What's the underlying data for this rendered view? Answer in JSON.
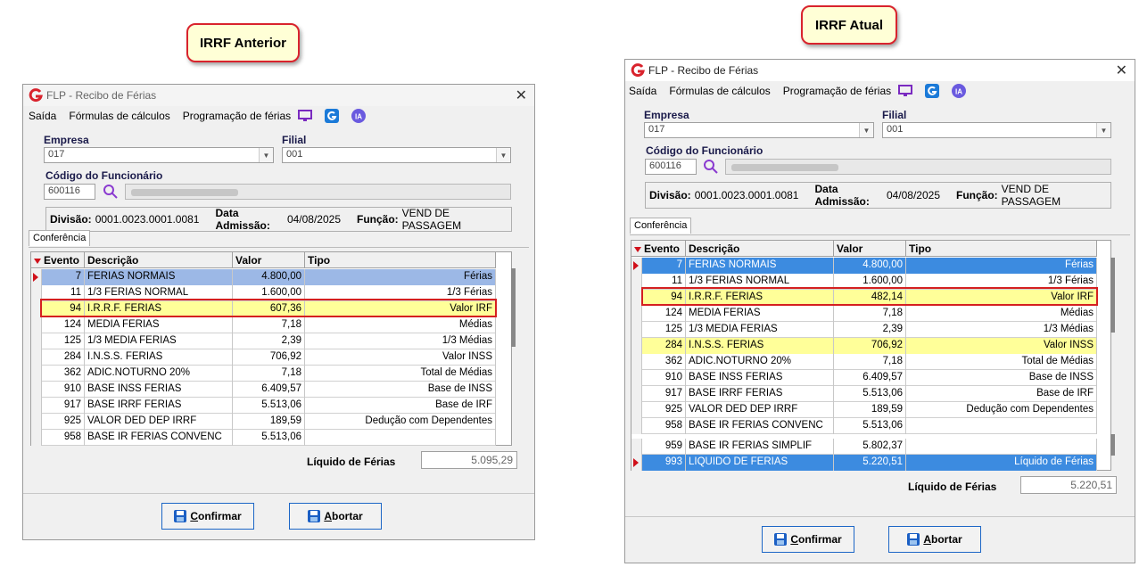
{
  "callouts": {
    "left": "IRRF Anterior",
    "right": "IRRF Atual"
  },
  "window": {
    "title": "FLP - Recibo de Férias",
    "close_glyph": "✕",
    "menu": {
      "exit": "Saída",
      "formulas": "Fórmulas de cálculos",
      "programacao": "Programação de férias"
    },
    "icons": [
      "monitor-icon",
      "g-logo-icon",
      "ia-icon"
    ],
    "ia_label": "IA",
    "labels": {
      "empresa": "Empresa",
      "filial": "Filial",
      "codigo": "Código do Funcionário"
    },
    "empresa_value": "017",
    "filial_value": "001",
    "codigo_value": "600116",
    "info": {
      "divisao_label": "Divisão:",
      "divisao_value": "0001.0023.0001.0081",
      "admissao_label": "Data Admissão:",
      "admissao_value": "04/08/2025",
      "funcao_label": "Função:",
      "funcao_value": "VEND DE PASSAGEM"
    },
    "tab": "Conferência",
    "columns": [
      "Evento",
      "Descrição",
      "Valor",
      "Tipo"
    ],
    "liquido_label": "Líquido de Férias",
    "buttons": {
      "confirm": "Confirmar",
      "abort": "Abortar"
    }
  },
  "left": {
    "rows": [
      {
        "evento": "7",
        "descricao": "FERIAS NORMAIS",
        "valor": "4.800,00",
        "tipo": "Férias"
      },
      {
        "evento": "11",
        "descricao": "1/3 FERIAS NORMAL",
        "valor": "1.600,00",
        "tipo": "1/3 Férias"
      },
      {
        "evento": "94",
        "descricao": "I.R.R.F. FERIAS",
        "valor": "607,36",
        "tipo": "Valor IRF"
      },
      {
        "evento": "124",
        "descricao": "MEDIA FERIAS",
        "valor": "7,18",
        "tipo": "Médias"
      },
      {
        "evento": "125",
        "descricao": "1/3 MEDIA FERIAS",
        "valor": "2,39",
        "tipo": "1/3 Médias"
      },
      {
        "evento": "284",
        "descricao": "I.N.S.S. FERIAS",
        "valor": "706,92",
        "tipo": "Valor INSS"
      },
      {
        "evento": "362",
        "descricao": "ADIC.NOTURNO 20%",
        "valor": "7,18",
        "tipo": "Total de Médias"
      },
      {
        "evento": "910",
        "descricao": "BASE INSS FERIAS",
        "valor": "6.409,57",
        "tipo": "Base de INSS"
      },
      {
        "evento": "917",
        "descricao": "BASE IRRF FERIAS",
        "valor": "5.513,06",
        "tipo": "Base de IRF"
      },
      {
        "evento": "925",
        "descricao": "VALOR DED DEP IRRF",
        "valor": "189,59",
        "tipo": "Dedução com Dependentes"
      },
      {
        "evento": "958",
        "descricao": "BASE IR FERIAS CONVENC",
        "valor": "5.513,06",
        "tipo": ""
      }
    ],
    "liquido_value": "5.095,29"
  },
  "right": {
    "rows": [
      {
        "evento": "7",
        "descricao": "FERIAS NORMAIS",
        "valor": "4.800,00",
        "tipo": "Férias"
      },
      {
        "evento": "11",
        "descricao": "1/3 FERIAS NORMAL",
        "valor": "1.600,00",
        "tipo": "1/3 Férias"
      },
      {
        "evento": "94",
        "descricao": "I.R.R.F. FERIAS",
        "valor": "482,14",
        "tipo": "Valor IRF"
      },
      {
        "evento": "124",
        "descricao": "MEDIA FERIAS",
        "valor": "7,18",
        "tipo": "Médias"
      },
      {
        "evento": "125",
        "descricao": "1/3 MEDIA FERIAS",
        "valor": "2,39",
        "tipo": "1/3 Médias"
      },
      {
        "evento": "284",
        "descricao": "I.N.S.S. FERIAS",
        "valor": "706,92",
        "tipo": "Valor INSS"
      },
      {
        "evento": "362",
        "descricao": "ADIC.NOTURNO 20%",
        "valor": "7,18",
        "tipo": "Total de Médias"
      },
      {
        "evento": "910",
        "descricao": "BASE INSS FERIAS",
        "valor": "6.409,57",
        "tipo": "Base de INSS"
      },
      {
        "evento": "917",
        "descricao": "BASE IRRF FERIAS",
        "valor": "5.513,06",
        "tipo": "Base de IRF"
      },
      {
        "evento": "925",
        "descricao": "VALOR DED DEP IRRF",
        "valor": "189,59",
        "tipo": "Dedução com Dependentes"
      },
      {
        "evento": "958",
        "descricao": "BASE IR FERIAS CONVENC",
        "valor": "5.513,06",
        "tipo": ""
      },
      {
        "evento": "959",
        "descricao": "BASE IR FERIAS SIMPLIF",
        "valor": "5.802,37",
        "tipo": ""
      },
      {
        "evento": "993",
        "descricao": "LIQUIDO DE FERIAS",
        "valor": "5.220,51",
        "tipo": "Líquido de Férias"
      }
    ],
    "liquido_value": "5.220,51"
  },
  "colors": {
    "highlight": "#ffff99",
    "selection": "#3c8be0",
    "callout_border": "#d9232d",
    "callout_bg": "#ffffd6",
    "button_border": "#1c66c6"
  }
}
